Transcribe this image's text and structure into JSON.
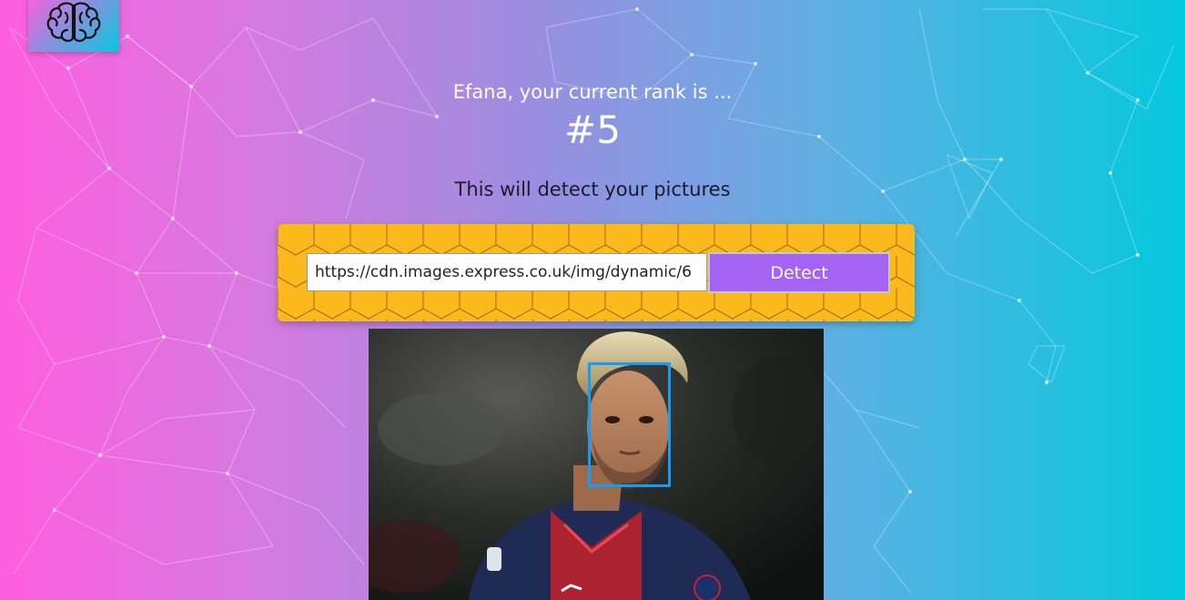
{
  "header": {
    "logo_icon": "brain-icon"
  },
  "rank": {
    "message": "Efana, your current rank is ...",
    "value": "#5"
  },
  "intro": {
    "text": "This will detect your pictures"
  },
  "form": {
    "url_value": "https://cdn.images.express.co.uk/img/dynamic/6",
    "button_label": "Detect"
  },
  "result": {
    "face_count": 1
  },
  "colors": {
    "gradient_left": "#ff5edf",
    "gradient_right": "#04c8de",
    "panel": "#fbb91b",
    "button": "#a463f2",
    "face_box": "#149df2"
  }
}
